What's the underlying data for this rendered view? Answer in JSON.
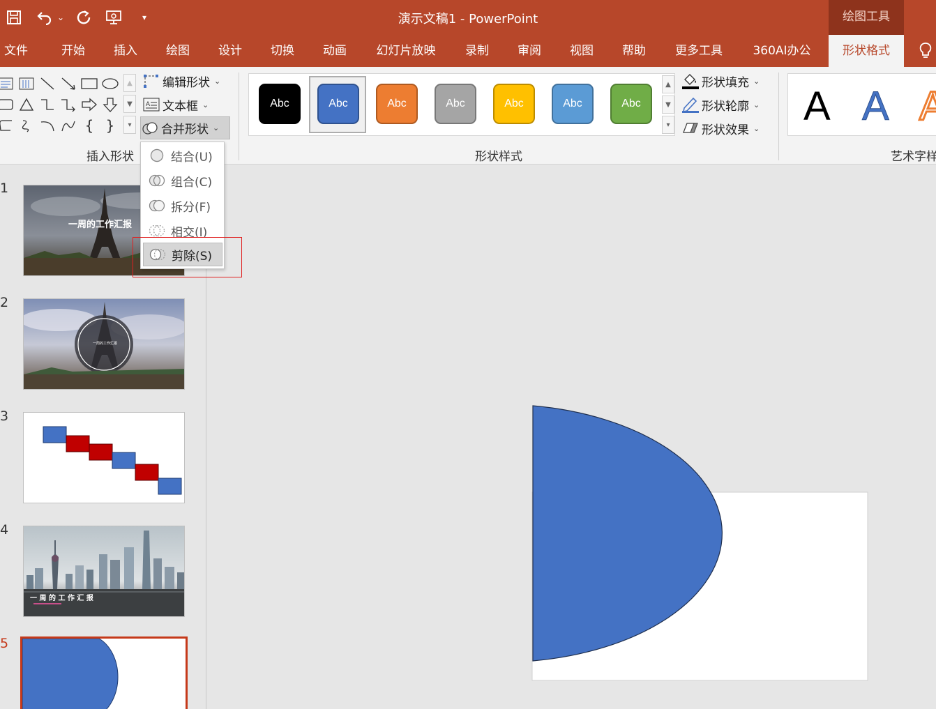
{
  "title_bar": {
    "app_title": "演示文稿1  -  PowerPoint",
    "context_tab": "绘图工具",
    "qat": [
      {
        "name": "save-icon",
        "glyph": "💾"
      },
      {
        "name": "undo-icon",
        "glyph": "↶"
      },
      {
        "name": "undo-dropdown-icon",
        "glyph": "⌄"
      },
      {
        "name": "redo-icon",
        "glyph": "↻"
      },
      {
        "name": "present-icon",
        "glyph": "▭"
      },
      {
        "name": "customize-qat-icon",
        "glyph": "▾"
      }
    ]
  },
  "tabs": [
    "文件",
    "开始",
    "插入",
    "绘图",
    "设计",
    "切换",
    "动画",
    "幻灯片放映",
    "录制",
    "审阅",
    "视图",
    "帮助",
    "更多工具",
    "360AI办公",
    "形状格式"
  ],
  "active_tab": "形状格式",
  "ribbon": {
    "insert_shapes": {
      "label": "插入形状",
      "edit_shape": "编辑形状",
      "text_box": "文本框",
      "merge_shapes": "合并形状"
    },
    "shape_styles": {
      "label": "形状样式",
      "thumbs": [
        {
          "text": "Abc",
          "fill": "#000000",
          "border": "#000000"
        },
        {
          "text": "Abc",
          "fill": "#4472c4",
          "border": "#2f528f"
        },
        {
          "text": "Abc",
          "fill": "#ed7d31",
          "border": "#ae5a21"
        },
        {
          "text": "Abc",
          "fill": "#a5a5a5",
          "border": "#787878"
        },
        {
          "text": "Abc",
          "fill": "#ffc000",
          "border": "#bc8c00"
        },
        {
          "text": "Abc",
          "fill": "#5b9bd5",
          "border": "#41719c"
        },
        {
          "text": "Abc",
          "fill": "#70ad47",
          "border": "#507e32"
        }
      ],
      "fill": "形状填充",
      "outline": "形状轮廓",
      "effect": "形状效果"
    },
    "wordart": {
      "label": "艺术字样式",
      "samples": [
        {
          "text": "A",
          "color": "#000000"
        },
        {
          "text": "A",
          "color": "#4472c4"
        },
        {
          "text": "A",
          "color": "#ed7d31"
        }
      ]
    }
  },
  "merge_menu": [
    {
      "text": "结合(U)",
      "icon": "union-icon"
    },
    {
      "text": "组合(C)",
      "icon": "combine-icon"
    },
    {
      "text": "拆分(F)",
      "icon": "fragment-icon"
    },
    {
      "text": "相交(I)",
      "icon": "intersect-icon"
    },
    {
      "text": "剪除(S)",
      "icon": "subtract-icon"
    }
  ],
  "slides": [
    {
      "num": "1",
      "caption": "一周的工作汇报"
    },
    {
      "num": "2",
      "caption": "一周的工作汇报"
    },
    {
      "num": "3",
      "caption": ""
    },
    {
      "num": "4",
      "caption": "一 周 的 工 作 汇 报"
    },
    {
      "num": "5",
      "caption": ""
    }
  ],
  "current_slide": "5",
  "colors": {
    "accent": "#b7472a",
    "shape_blue": "#4472c4",
    "red_block": "#c00000"
  }
}
